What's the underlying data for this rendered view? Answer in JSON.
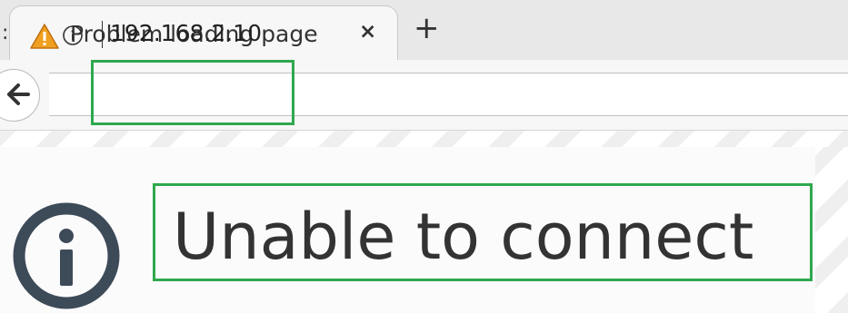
{
  "tab": {
    "title": "Problem loading page",
    "close_glyph": "×",
    "icon": "warning-icon"
  },
  "new_tab_glyph": "+",
  "navbar": {
    "back_icon": "back-arrow-icon",
    "site_info_icon": "info-icon",
    "url": "192.168.2.10"
  },
  "error": {
    "icon": "info-icon",
    "title": "Unable to connect"
  },
  "colors": {
    "highlight": "#2fa84f",
    "warning": "#f0a020",
    "icon_dark": "#3d4a58"
  }
}
